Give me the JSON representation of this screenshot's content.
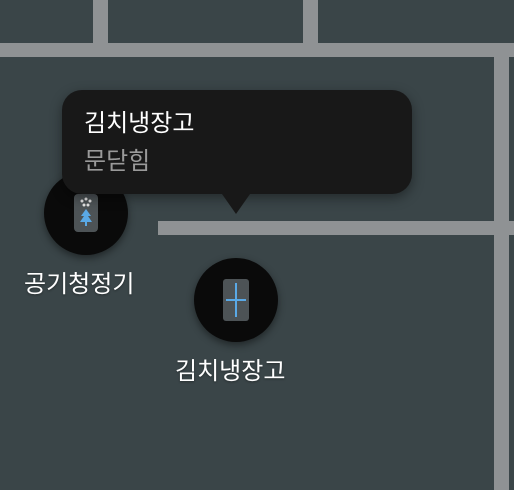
{
  "tooltip": {
    "title": "김치냉장고",
    "status": "문닫힘"
  },
  "devices": [
    {
      "label": "공기청정기",
      "icon": "air-purifier-icon"
    },
    {
      "label": "김치냉장고",
      "icon": "kimchi-refrigerator-icon"
    }
  ],
  "colors": {
    "floor": "#3a4548",
    "wall": "#8f9294",
    "tooltip_bg": "#181818",
    "device_bg": "#0a0a0a",
    "status_text": "#9a9a9a",
    "icon_accent": "#5aa9e6"
  }
}
